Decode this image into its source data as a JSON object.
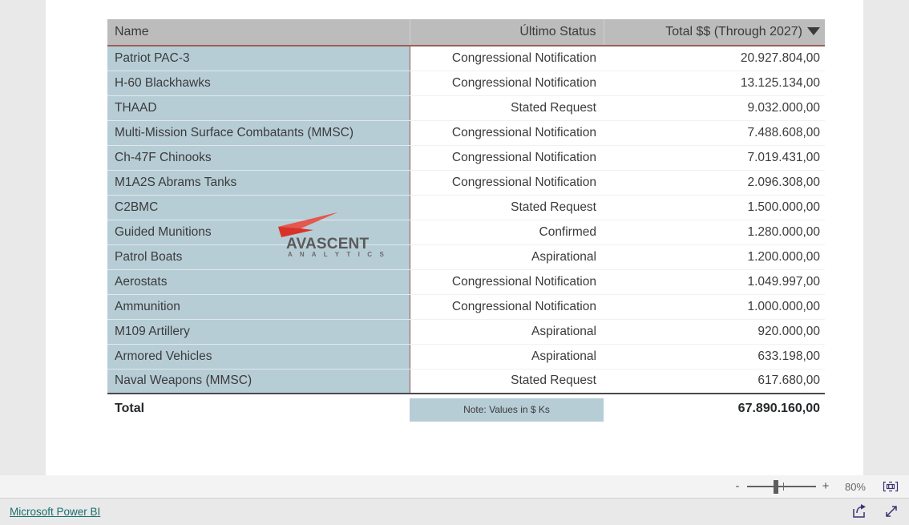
{
  "table": {
    "columns": [
      {
        "key": "name",
        "label": "Name",
        "align": "left"
      },
      {
        "key": "status",
        "label": "Último Status",
        "align": "right"
      },
      {
        "key": "total",
        "label": "Total $$ (Through 2027)",
        "align": "right",
        "sort": "descending",
        "sort_icon": "caret-down-icon"
      }
    ],
    "rows": [
      {
        "name": "Patriot PAC-3",
        "status": "Congressional Notification",
        "total": "20.927.804,00"
      },
      {
        "name": "H-60 Blackhawks",
        "status": "Congressional Notification",
        "total": "13.125.134,00"
      },
      {
        "name": "THAAD",
        "status": "Stated Request",
        "total": "9.032.000,00"
      },
      {
        "name": "Multi-Mission Surface Combatants (MMSC)",
        "status": "Congressional Notification",
        "total": "7.488.608,00"
      },
      {
        "name": "Ch-47F Chinooks",
        "status": "Congressional Notification",
        "total": "7.019.431,00"
      },
      {
        "name": "M1A2S Abrams Tanks",
        "status": "Congressional Notification",
        "total": "2.096.308,00"
      },
      {
        "name": "C2BMC",
        "status": "Stated Request",
        "total": "1.500.000,00"
      },
      {
        "name": "Guided Munitions",
        "status": "Confirmed",
        "total": "1.280.000,00"
      },
      {
        "name": "Patrol Boats",
        "status": "Aspirational",
        "total": "1.200.000,00"
      },
      {
        "name": "Aerostats",
        "status": "Congressional Notification",
        "total": "1.049.997,00"
      },
      {
        "name": "Ammunition",
        "status": "Congressional Notification",
        "total": "1.000.000,00"
      },
      {
        "name": "M109 Artillery",
        "status": "Aspirational",
        "total": "920.000,00"
      },
      {
        "name": "Armored Vehicles",
        "status": "Aspirational",
        "total": "633.198,00"
      },
      {
        "name": "Naval Weapons (MMSC)",
        "status": "Stated Request",
        "total": "617.680,00"
      }
    ],
    "total_row": {
      "label": "Total",
      "note": "Note: Values in $ Ks",
      "total": "67.890.160,00"
    }
  },
  "watermark": {
    "name": "avascent-analytics-logo",
    "title": "AVASCENT",
    "subtitle": "A N A L Y T I C S",
    "mark_color": "#d8332a",
    "text_color": "#5a5a5a"
  },
  "zoom_bar": {
    "decrease_label": "-",
    "increase_label": "+",
    "level": "80%",
    "fit_icon": "fit-to-page-icon"
  },
  "footer": {
    "link_label": "Microsoft Power BI",
    "share_icon": "share-icon",
    "fullscreen_icon": "fullscreen-icon"
  },
  "colors": {
    "page_background": "#e9e9e9",
    "canvas": "#ffffff",
    "header_background": "#bcbcbc",
    "header_underline": "#9b5f57",
    "name_cell_background": "#b7cdd6",
    "note_chip_background": "#b7cdd6",
    "link": "#17706e",
    "icon": "#3b3273"
  }
}
